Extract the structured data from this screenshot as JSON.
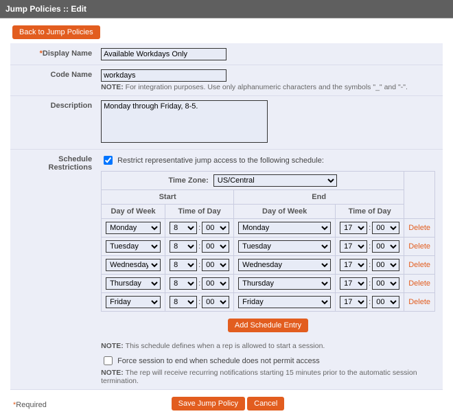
{
  "header": {
    "title": "Jump Policies :: Edit"
  },
  "back_button": "Back to Jump Policies",
  "labels": {
    "display_name": "Display Name",
    "code_name": "Code Name",
    "description": "Description",
    "schedule": "Schedule Restrictions",
    "required_marker": "*"
  },
  "fields": {
    "display_name": "Available Workdays Only",
    "code_name": "workdays",
    "code_name_note": "For integration purposes. Use only alphanumeric characters and the symbols \"_\" and \"-\".",
    "description": "Monday through Friday, 8-5."
  },
  "schedule": {
    "restrict_checked": true,
    "restrict_label": "Restrict representative jump access to the following schedule:",
    "timezone_label": "Time Zone:",
    "timezone_value": "US/Central",
    "table": {
      "col_start": "Start",
      "col_end": "End",
      "col_dow": "Day of Week",
      "col_tod": "Time of Day"
    },
    "rows": [
      {
        "start_dow": "Monday",
        "start_h": "8",
        "start_m": "00",
        "end_dow": "Monday",
        "end_h": "17",
        "end_m": "00"
      },
      {
        "start_dow": "Tuesday",
        "start_h": "8",
        "start_m": "00",
        "end_dow": "Tuesday",
        "end_h": "17",
        "end_m": "00"
      },
      {
        "start_dow": "Wednesday",
        "start_h": "8",
        "start_m": "00",
        "end_dow": "Wednesday",
        "end_h": "17",
        "end_m": "00"
      },
      {
        "start_dow": "Thursday",
        "start_h": "8",
        "start_m": "00",
        "end_dow": "Thursday",
        "end_h": "17",
        "end_m": "00"
      },
      {
        "start_dow": "Friday",
        "start_h": "8",
        "start_m": "00",
        "end_dow": "Friday",
        "end_h": "17",
        "end_m": "00"
      }
    ],
    "delete_label": "Delete",
    "add_entry": "Add Schedule Entry",
    "note_after": "This schedule defines when a rep is allowed to start a session.",
    "force_end_label": "Force session to end when schedule does not permit access",
    "force_end_checked": false,
    "note_force": "The rep will receive recurring notifications starting 15 minutes prior to the automatic session termination."
  },
  "footer": {
    "required_text": "Required",
    "save": "Save Jump Policy",
    "cancel": "Cancel",
    "note_prefix": "NOTE: "
  }
}
